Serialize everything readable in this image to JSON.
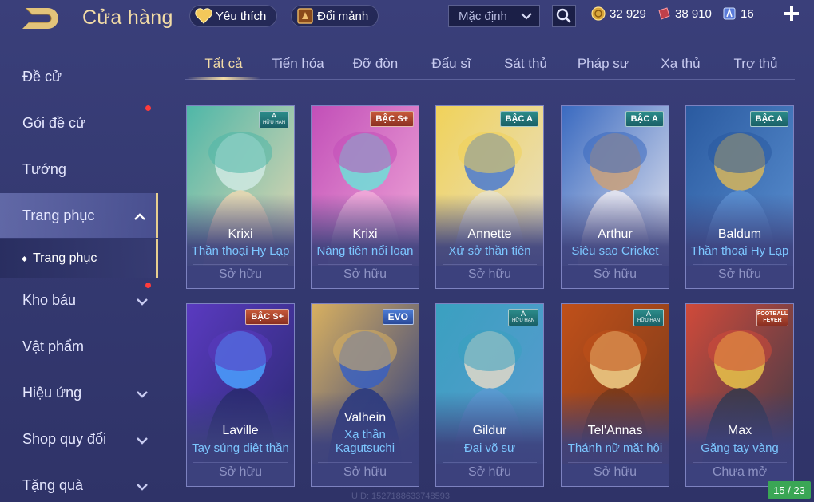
{
  "header": {
    "title": "Cửa hàng",
    "favorites_label": "Yêu thích",
    "fragments_label": "Đổi mảnh",
    "sort_value": "Mặc định",
    "currencies": {
      "gold": "32 929",
      "voucher": "38 910",
      "quan_huy": "16"
    }
  },
  "sidebar": {
    "items": [
      {
        "label": "Đề cử"
      },
      {
        "label": "Gói đề cử"
      },
      {
        "label": "Tướng"
      },
      {
        "label": "Trang phục"
      },
      {
        "label": "Kho báu"
      },
      {
        "label": "Vật phẩm"
      },
      {
        "label": "Hiệu ứng"
      },
      {
        "label": "Shop quy đổi"
      },
      {
        "label": "Tặng quà"
      }
    ],
    "sub_item": "Trang phục"
  },
  "tabs": [
    "Tất cả",
    "Tiến hóa",
    "Đỡ đòn",
    "Đấu sĩ",
    "Sát thủ",
    "Pháp sư",
    "Xạ thủ",
    "Trợ thủ"
  ],
  "cards": [
    {
      "hero": "Krixi",
      "skin": "Thần thoại Hy Lạp",
      "status": "Sở hữu",
      "badge": "A",
      "badge_sub": "HỮU HẠN",
      "colors": [
        "#4fb7a8",
        "#cfe9e2",
        "#e7d7b2"
      ]
    },
    {
      "hero": "Krixi",
      "skin": "Nàng tiên nổi loạn",
      "status": "Sở hữu",
      "badge": "BẬC S+",
      "colors": [
        "#c24fb8",
        "#6de0d8",
        "#f0a8d8"
      ]
    },
    {
      "hero": "Annette",
      "skin": "Xứ sở thần tiên",
      "status": "Sở hữu",
      "badge": "BẬC A",
      "colors": [
        "#f0d25a",
        "#4a7ad0",
        "#e8e0c8"
      ]
    },
    {
      "hero": "Arthur",
      "skin": "Siêu sao Cricket",
      "status": "Sở hữu",
      "badge": "BẬC A",
      "colors": [
        "#3a6ac0",
        "#c9a07a",
        "#e6e6f0"
      ]
    },
    {
      "hero": "Baldum",
      "skin": "Thần thoại Hy Lạp",
      "status": "Sở hữu",
      "badge": "BẬC A",
      "colors": [
        "#2a5aa0",
        "#d6b55a",
        "#5a8fd0"
      ]
    },
    {
      "hero": "Laville",
      "skin": "Tay súng diệt thần",
      "status": "Sở hữu",
      "badge": "BẬC S+",
      "colors": [
        "#5a3ac0",
        "#4aa0ff",
        "#2a2a70"
      ]
    },
    {
      "hero": "Valhein",
      "skin": "Xạ thần Kagutsuchi",
      "status": "Sở hữu",
      "badge": "EVO",
      "colors": [
        "#d8b060",
        "#3a60c0",
        "#2a3a80"
      ]
    },
    {
      "hero": "Gildur",
      "skin": "Đại võ sư",
      "status": "Sở hữu",
      "badge": "A",
      "badge_sub": "HỮU HẠN",
      "colors": [
        "#3aa0c0",
        "#e0d8c8",
        "#5a9ad0"
      ]
    },
    {
      "hero": "Tel'Annas",
      "skin": "Thánh nữ mặt hội",
      "status": "Sở hữu",
      "badge": "A",
      "badge_sub": "HỮU HẠN",
      "colors": [
        "#c0501a",
        "#f0d08a",
        "#7a3a1a"
      ]
    },
    {
      "hero": "Max",
      "skin": "Găng tay vàng",
      "status": "Chưa mở",
      "badge": "FOOTBALL FEVER",
      "colors": [
        "#d04a3a",
        "#e8c24a",
        "#3a3a4a"
      ]
    }
  ],
  "pagination": "15 / 23",
  "uid": "UID: 1527188633748593"
}
